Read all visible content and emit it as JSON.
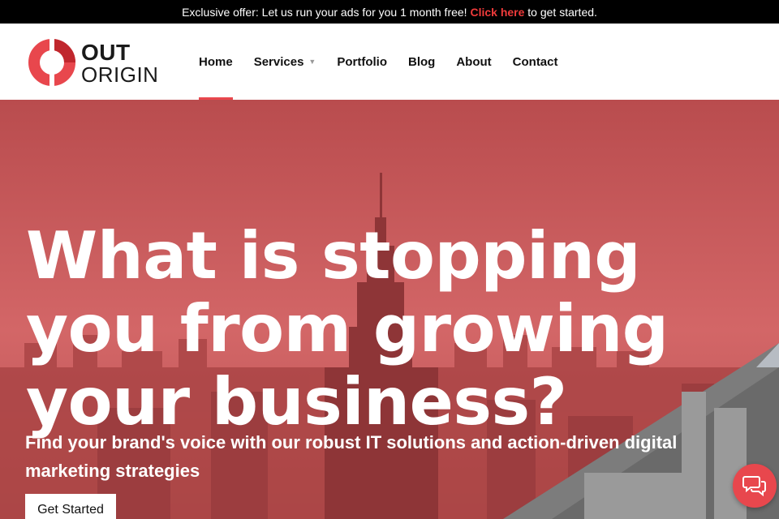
{
  "promo": {
    "text_before": "Exclusive offer: Let us run your ads for you 1 month free! ",
    "link_text": "Click here",
    "text_after": " to get started."
  },
  "logo": {
    "line1": "OUT",
    "line2": "ORIGIN"
  },
  "nav": {
    "items": [
      {
        "label": "Home",
        "active": true
      },
      {
        "label": "Services",
        "has_dropdown": true
      },
      {
        "label": "Portfolio"
      },
      {
        "label": "Blog"
      },
      {
        "label": "About"
      },
      {
        "label": "Contact"
      }
    ]
  },
  "hero": {
    "title": "What is stopping you from growing your business?",
    "subtitle": "Find your brand's voice with our robust IT solutions and action-driven digital marketing strategies",
    "cta_label": "Get Started"
  },
  "chat": {
    "icon": "chat-bubbles-icon"
  },
  "colors": {
    "accent": "#e8474d",
    "hero_overlay": "#c95a5b",
    "promo_bg": "#000000",
    "promo_link": "#ef3b3b"
  }
}
